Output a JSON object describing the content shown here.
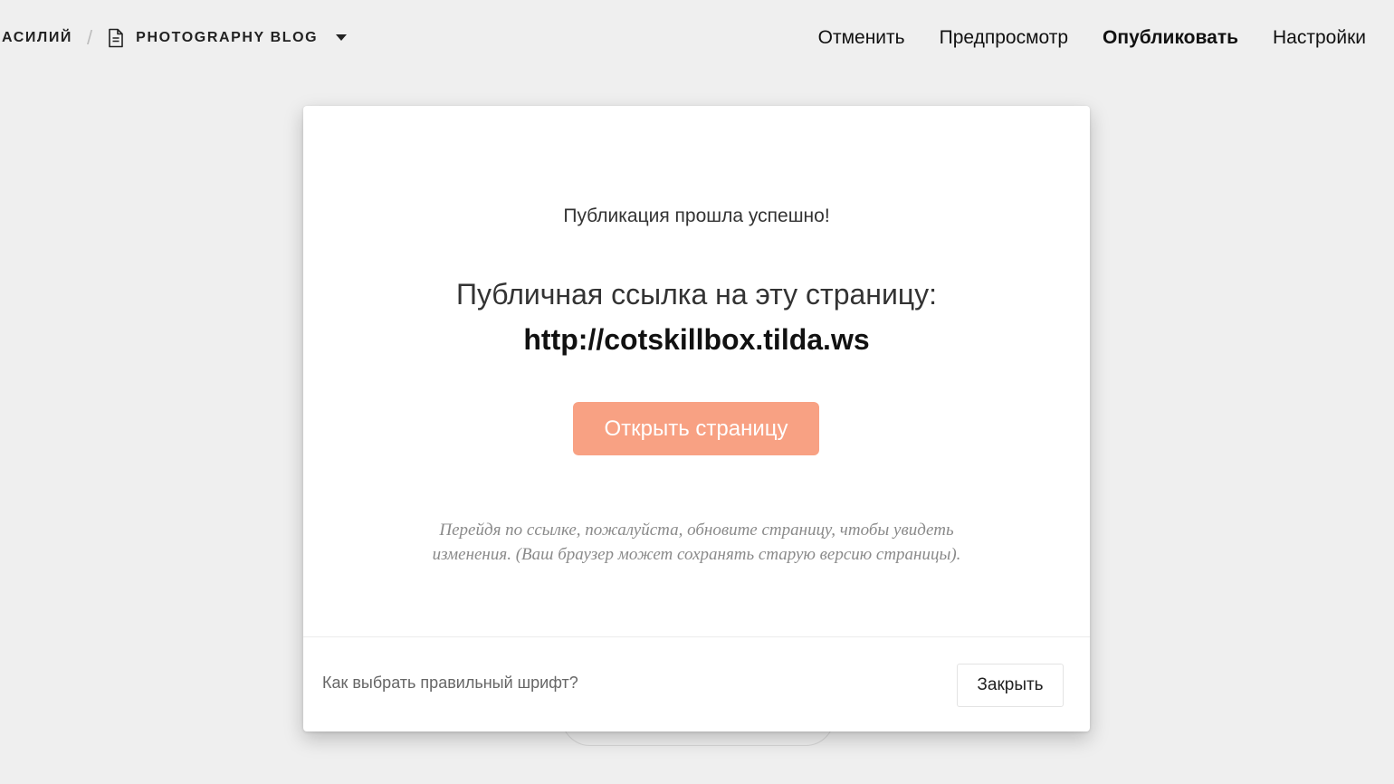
{
  "header": {
    "project_name": "АСИЛИЙ",
    "separator": "/",
    "page_icon": "document-icon",
    "page_name": "PHOTOGRAPHY BLOG",
    "dropdown_icon": "caret-down-icon",
    "actions": {
      "cancel": "Отменить",
      "preview": "Предпросмотр",
      "publish": "Опубликовать",
      "settings": "Настройки"
    }
  },
  "modal": {
    "status": "Публикация прошла успешно!",
    "link_heading": "Публичная ссылка на эту страницу:",
    "url": "http://cotskillbox.tilda.ws",
    "open_button": "Открыть страницу",
    "note": "Перейдя по ссылке, пожалуйста, обновите страницу, чтобы увидеть изменения. (Ваш браузер может сохранять старую версию страницы).",
    "help_link": "Как выбрать правильный шрифт?",
    "close_button": "Закрыть"
  },
  "colors": {
    "background": "#efefef",
    "accent_button": "#f8a183",
    "note_text": "#8a8a8a"
  }
}
